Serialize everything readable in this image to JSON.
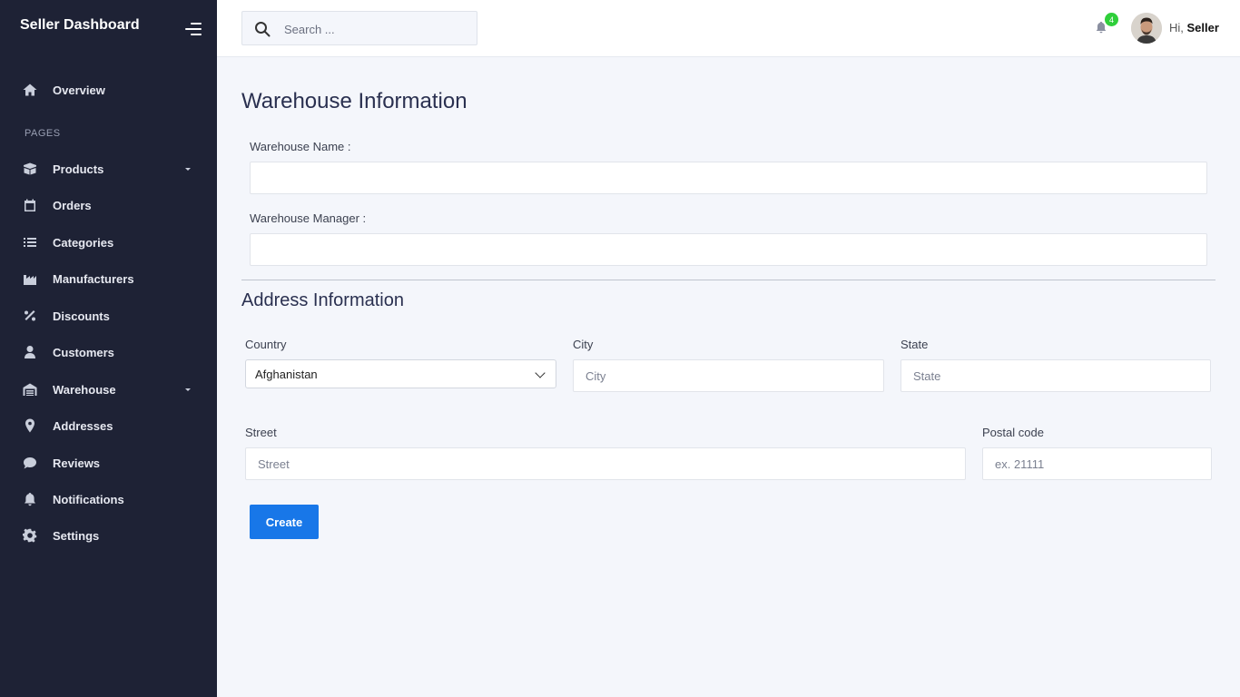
{
  "sidebar": {
    "brand": "Seller Dashboard",
    "section_label": "PAGES",
    "items": [
      {
        "label": "Overview",
        "icon": "home-icon"
      },
      {
        "label": "Products",
        "icon": "box-icon",
        "has_submenu": true
      },
      {
        "label": "Orders",
        "icon": "calendar-icon"
      },
      {
        "label": "Categories",
        "icon": "list-icon"
      },
      {
        "label": "Manufacturers",
        "icon": "factory-icon"
      },
      {
        "label": "Discounts",
        "icon": "percent-icon"
      },
      {
        "label": "Customers",
        "icon": "user-icon"
      },
      {
        "label": "Warehouse",
        "icon": "warehouse-icon",
        "has_submenu": true
      },
      {
        "label": "Addresses",
        "icon": "map-pin-icon"
      },
      {
        "label": "Reviews",
        "icon": "comment-icon"
      },
      {
        "label": "Notifications",
        "icon": "bell-icon"
      },
      {
        "label": "Settings",
        "icon": "gear-icon"
      }
    ]
  },
  "topbar": {
    "search_placeholder": "Search ...",
    "notification_count": "4",
    "greeting_prefix": "Hi,",
    "user_name": "Seller"
  },
  "main": {
    "title": "Warehouse Information",
    "warehouse_name_label": "Warehouse Name :",
    "warehouse_name_value": "",
    "warehouse_manager_label": "Warehouse Manager :",
    "warehouse_manager_value": "",
    "address_title": "Address Information",
    "country_label": "Country",
    "country_value": "Afghanistan",
    "city_label": "City",
    "city_placeholder": "City",
    "state_label": "State",
    "state_placeholder": "State",
    "street_label": "Street",
    "street_placeholder": "Street",
    "postal_label": "Postal code",
    "postal_placeholder": "ex. 21111",
    "create_label": "Create"
  },
  "colors": {
    "sidebar_bg": "#1e2235",
    "accent": "#1877e8",
    "badge": "#2fcf3a",
    "page_bg": "#f4f6fb"
  }
}
